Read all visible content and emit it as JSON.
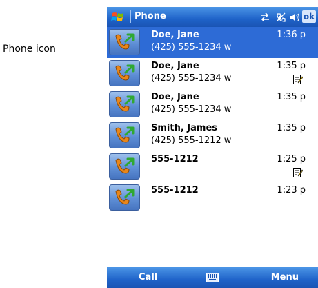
{
  "annotation": {
    "callout_label": "Phone icon"
  },
  "title_bar": {
    "title": "Phone",
    "ok_label": "ok"
  },
  "call_list": [
    {
      "name": "Doe, Jane",
      "number": "(425) 555-1234 w",
      "time": "1:36 p",
      "has_note": false,
      "selected": true
    },
    {
      "name": "Doe, Jane",
      "number": "(425) 555-1234 w",
      "time": "1:35 p",
      "has_note": true,
      "selected": false
    },
    {
      "name": "Doe, Jane",
      "number": "(425) 555-1234 w",
      "time": "1:35 p",
      "has_note": false,
      "selected": false
    },
    {
      "name": "Smith, James",
      "number": "(425) 555-1212 w",
      "time": "1:35 p",
      "has_note": false,
      "selected": false
    },
    {
      "name": "555-1212",
      "number": "",
      "time": "1:25 p",
      "has_note": true,
      "selected": false
    },
    {
      "name": "555-1212",
      "number": "",
      "time": "1:23 p",
      "has_note": false,
      "selected": false
    }
  ],
  "menu_bar": {
    "left_label": "Call",
    "right_label": "Menu"
  },
  "colors": {
    "accent": "#1f63c9",
    "selected_row": "#2d6bd6",
    "phone_green": "#2fa832",
    "handset_orange": "#e8861a"
  },
  "icons": {
    "phone": "phone-icon",
    "note": "note-icon",
    "keyboard": "keyboard-icon",
    "start": "windows-flag-icon"
  }
}
